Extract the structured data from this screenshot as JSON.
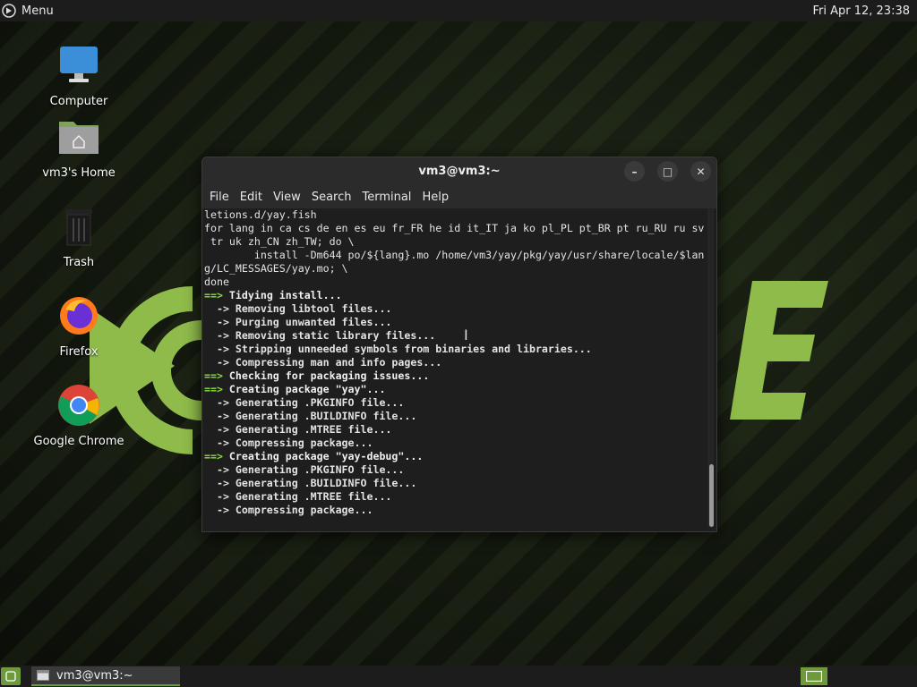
{
  "top_panel": {
    "menu_label": "Menu",
    "clock": "Fri Apr 12, 23:38"
  },
  "desktop_icons": [
    {
      "label": "Computer",
      "icon": "computer-icon"
    },
    {
      "label": "vm3's Home",
      "icon": "home-folder-icon"
    },
    {
      "label": "Trash",
      "icon": "trash-icon"
    },
    {
      "label": "Firefox",
      "icon": "firefox-icon"
    },
    {
      "label": "Google Chrome",
      "icon": "chrome-icon"
    }
  ],
  "terminal": {
    "title": "vm3@vm3:~",
    "menu": [
      "File",
      "Edit",
      "View",
      "Search",
      "Terminal",
      "Help"
    ],
    "lines": [
      "letions.d/yay.fish",
      "for lang in ca cs de en es eu fr_FR he id it_IT ja ko pl_PL pt_BR pt ru_RU ru sv",
      " tr uk zh_CN zh_TW; do \\",
      "        install -Dm644 po/${lang}.mo /home/vm3/yay/pkg/yay/usr/share/locale/$lan",
      "g/LC_MESSAGES/yay.mo; \\",
      "done",
      "==> Tidying install...",
      "  -> Removing libtool files...",
      "  -> Purging unwanted files...",
      "  -> Removing static library files...",
      "  -> Stripping unneeded symbols from binaries and libraries...",
      "  -> Compressing man and info pages...",
      "==> Checking for packaging issues...",
      "==> Creating package \"yay\"...",
      "  -> Generating .PKGINFO file...",
      "  -> Generating .BUILDINFO file...",
      "  -> Generating .MTREE file...",
      "  -> Compressing package...",
      "==> Creating package \"yay-debug\"...",
      "  -> Generating .PKGINFO file...",
      "  -> Generating .BUILDINFO file...",
      "  -> Generating .MTREE file...",
      "  -> Compressing package..."
    ]
  },
  "taskbar": {
    "window_label": "vm3@vm3:~"
  },
  "colors": {
    "accent": "#6e9a3c",
    "prompt_arrow": "#8ae234"
  }
}
